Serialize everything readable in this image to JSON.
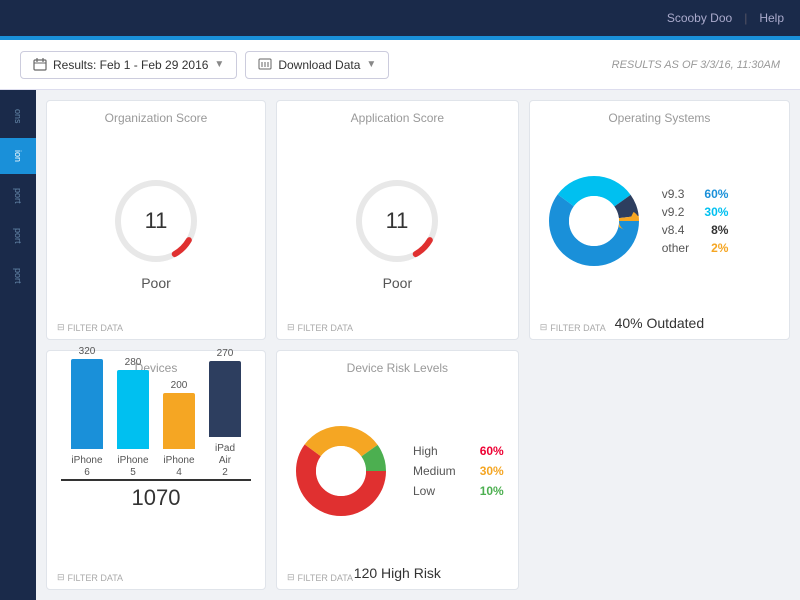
{
  "topnav": {
    "user": "Scooby Doo",
    "sep": "|",
    "help": "Help"
  },
  "toolbar": {
    "results_label": "Results: Feb 1 - Feb 29 2016",
    "download_label": "Download Data",
    "results_as_of": "RESULTS AS OF 3/3/16, 11:30AM"
  },
  "sidebar": {
    "items": [
      {
        "label": "ons",
        "active": false
      },
      {
        "label": "ion",
        "active": true
      },
      {
        "label": "port",
        "active": false
      },
      {
        "label": "port",
        "active": false
      },
      {
        "label": "port",
        "active": false
      }
    ]
  },
  "cards": {
    "org_score": {
      "title": "Organization Score",
      "value": "11",
      "label": "Poor",
      "filter": "FILTER DATA"
    },
    "app_score": {
      "title": "Application Score",
      "value": "11",
      "label": "Poor",
      "filter": "FILTER DATA"
    },
    "os": {
      "title": "Operating Systems",
      "legend": [
        {
          "version": "v9.3",
          "pct": "60%",
          "color": "c-blue"
        },
        {
          "version": "v9.2",
          "pct": "30%",
          "color": "c-lblue"
        },
        {
          "version": "v8.4",
          "pct": "8%",
          "color": "c-dark"
        },
        {
          "version": "other",
          "pct": "2%",
          "color": "c-orange"
        }
      ],
      "outdated": "40% Outdated",
      "filter": "FILTER DATA"
    },
    "devices": {
      "title": "Devices",
      "bars": [
        {
          "label": "iPhone\n6",
          "value": 320,
          "color": "#1a90d9"
        },
        {
          "label": "iPhone\n5",
          "value": 280,
          "color": "#00c0f0"
        },
        {
          "label": "iPhone\n4",
          "value": 200,
          "color": "#f5a623"
        },
        {
          "label": "iPad Air\n2",
          "value": 270,
          "color": "#2d3e5f"
        }
      ],
      "total": "1070",
      "filter": "FILTER DATA"
    },
    "device_risk": {
      "title": "Device Risk Levels",
      "legend": [
        {
          "label": "High",
          "pct": "60%",
          "color": "c-red"
        },
        {
          "label": "Medium",
          "pct": "30%",
          "color": "c-orange"
        },
        {
          "label": "Low",
          "pct": "10%",
          "color": "c-green"
        }
      ],
      "summary": "120 High Risk",
      "filter": "FILTER DATA"
    }
  },
  "icons": {
    "calendar": "📅",
    "download": "⬇",
    "filter": "⊟"
  }
}
